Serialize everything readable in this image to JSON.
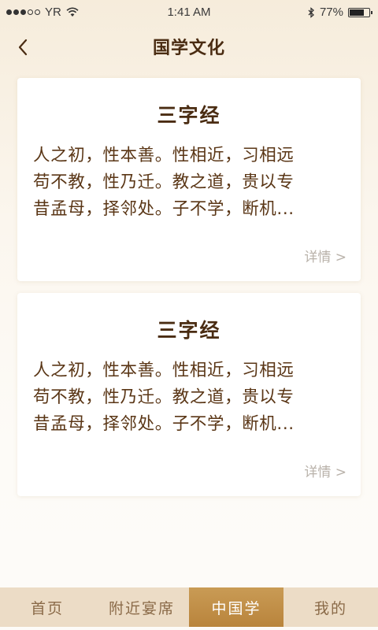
{
  "status_bar": {
    "carrier": "YR",
    "time": "1:41 AM",
    "battery": "77%",
    "battery_level": 0.77
  },
  "nav": {
    "title": "国学文化"
  },
  "cards": [
    {
      "title": "三字经",
      "lines": [
        "人之初，性本善。性相近，习相远",
        "苟不教，性乃迁。教之道，贵以专",
        "昔孟母，择邻处。子不学，断机..."
      ],
      "detail": "详情 >"
    },
    {
      "title": "三字经",
      "lines": [
        "人之初，性本善。性相近，习相远",
        "苟不教，性乃迁。教之道，贵以专",
        "昔孟母，择邻处。子不学，断机..."
      ],
      "detail": "详情 >"
    }
  ],
  "tabs": [
    {
      "label": "首页",
      "active": false
    },
    {
      "label": "附近宴席",
      "active": false
    },
    {
      "label": "中国学",
      "active": true
    },
    {
      "label": "我的",
      "active": false
    }
  ],
  "colors": {
    "accent": "#c0904a",
    "title_text": "#4a2c12",
    "muted": "#b9b2aa"
  }
}
